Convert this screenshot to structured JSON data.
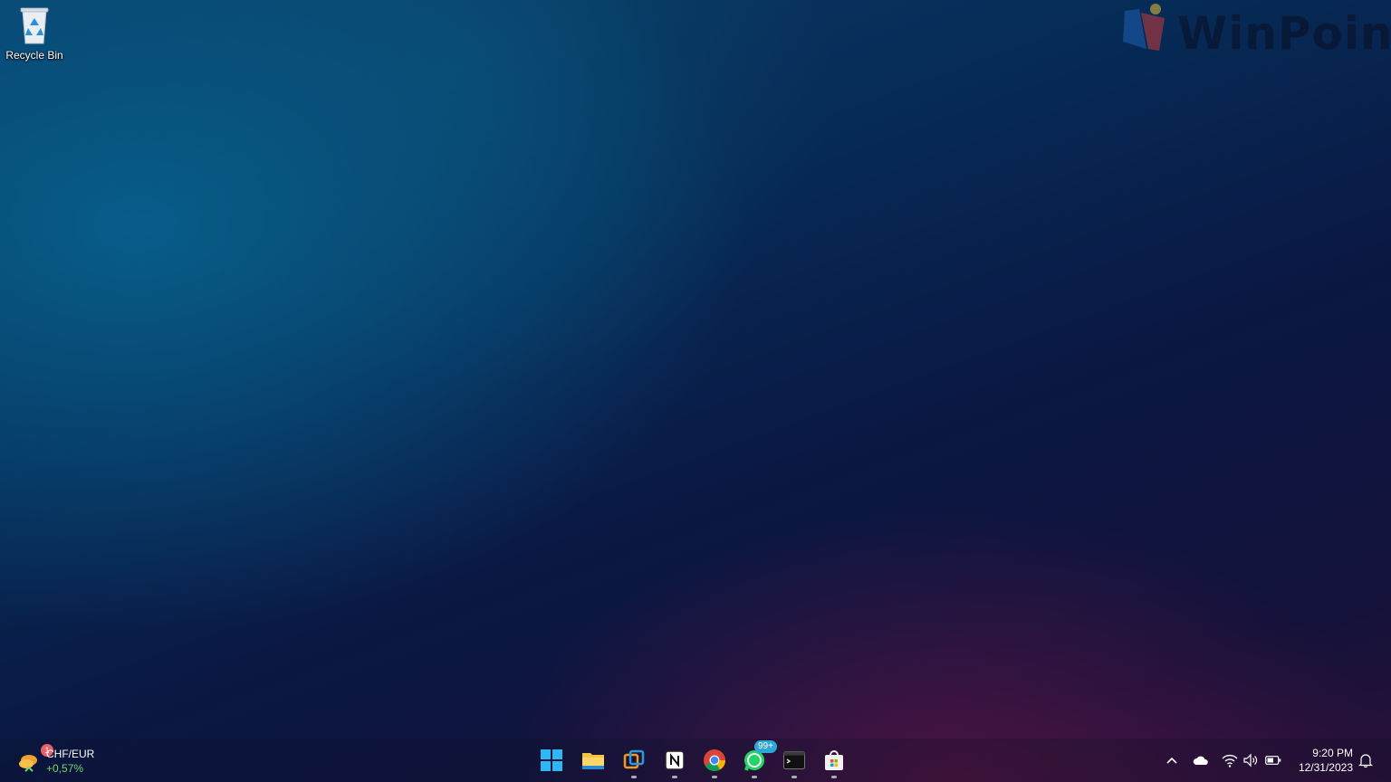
{
  "desktop": {
    "icons": [
      {
        "label": "Recycle Bin",
        "icon": "recycle-bin-icon"
      }
    ],
    "watermark": {
      "text": "WinPoin"
    }
  },
  "taskbar": {
    "widget": {
      "badge": "1",
      "pair": "CHF/EUR",
      "change": "+0,57%",
      "change_color": "#7ad36b"
    },
    "apps": [
      {
        "name": "Start",
        "icon": "windows-start-icon",
        "running": false
      },
      {
        "name": "File Explorer",
        "icon": "file-explorer-icon",
        "running": false
      },
      {
        "name": "Virtual Desktop",
        "icon": "virtual-box-icon",
        "running": true
      },
      {
        "name": "Notion",
        "icon": "notion-icon",
        "running": true
      },
      {
        "name": "Google Chrome",
        "icon": "chrome-icon",
        "running": true
      },
      {
        "name": "WhatsApp",
        "icon": "whatsapp-icon",
        "running": true,
        "badge": "99+"
      },
      {
        "name": "Terminal",
        "icon": "terminal-icon",
        "running": true
      },
      {
        "name": "Microsoft Store",
        "icon": "store-icon",
        "running": true
      }
    ],
    "tray": {
      "icons": [
        "chevron-up-icon",
        "onedrive-icon",
        "wifi-icon",
        "volume-icon",
        "battery-icon"
      ],
      "time": "9:20 PM",
      "date": "12/31/2023",
      "notification_icon": "bell-icon"
    }
  }
}
